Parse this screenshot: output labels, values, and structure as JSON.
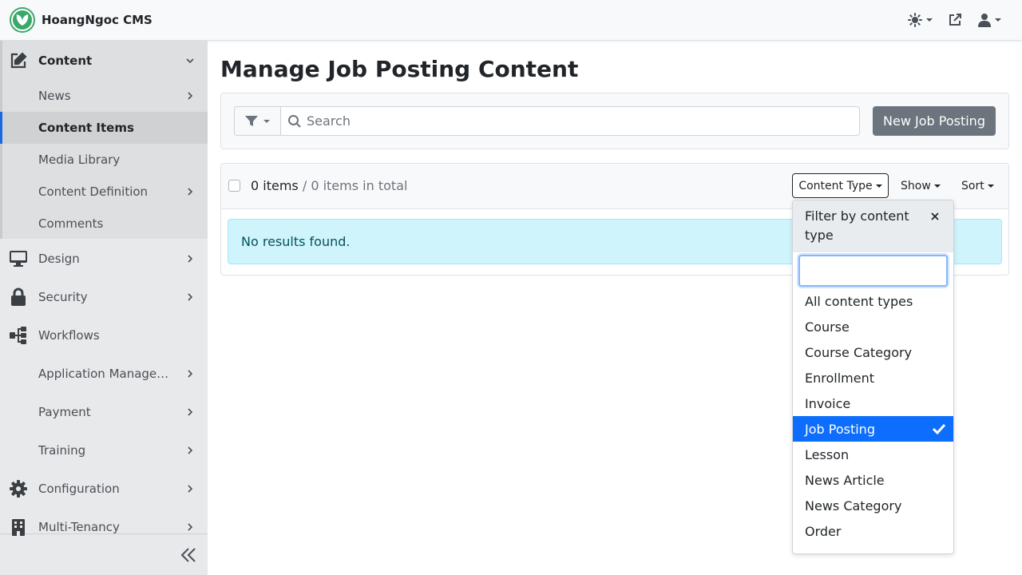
{
  "app": {
    "name": "HoangNgoc CMS"
  },
  "sidebar": {
    "content": {
      "label": "Content",
      "children": [
        {
          "label": "News"
        },
        {
          "label": "Content Items"
        },
        {
          "label": "Media Library"
        },
        {
          "label": "Content Definition"
        },
        {
          "label": "Comments"
        }
      ]
    },
    "items": [
      {
        "label": "Design",
        "icon": "monitor-icon"
      },
      {
        "label": "Security",
        "icon": "lock-icon"
      },
      {
        "label": "Workflows",
        "icon": "sitemap-icon"
      },
      {
        "label": "Application Management"
      },
      {
        "label": "Payment"
      },
      {
        "label": "Training"
      },
      {
        "label": "Configuration",
        "icon": "cog-icon"
      },
      {
        "label": "Multi-Tenancy",
        "icon": "building-icon"
      }
    ]
  },
  "main": {
    "title": "Manage Job Posting Content",
    "search_placeholder": "Search",
    "new_button": "New Job Posting",
    "items_count": "0 items",
    "items_total": " / 0 items in total",
    "content_type_button": "Content Type",
    "show_button": "Show",
    "sort_button": "Sort",
    "no_results": "No results found."
  },
  "dropdown": {
    "title": "Filter by content type",
    "options": [
      {
        "label": "All content types"
      },
      {
        "label": "Course"
      },
      {
        "label": "Course Category"
      },
      {
        "label": "Enrollment"
      },
      {
        "label": "Invoice"
      },
      {
        "label": "Job Posting",
        "selected": true
      },
      {
        "label": "Lesson"
      },
      {
        "label": "News Article"
      },
      {
        "label": "News Category"
      },
      {
        "label": "Order"
      }
    ]
  },
  "colors": {
    "accent": "#0d6efd",
    "brand": "#3aa86a",
    "alert_bg": "#cff4fc"
  }
}
